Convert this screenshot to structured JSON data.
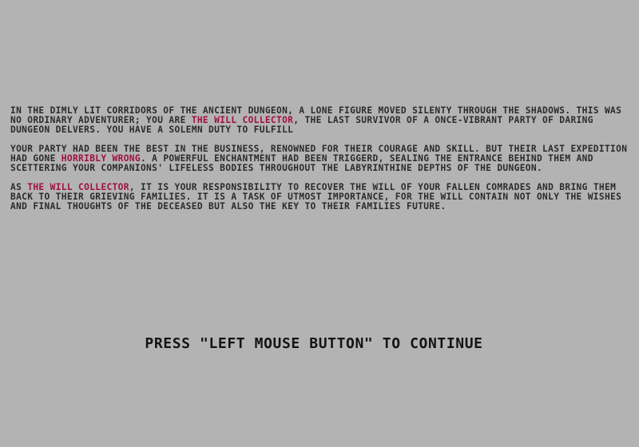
{
  "colors": {
    "background": "#b3b3b3",
    "text": "#2b2b2b",
    "highlight": "#a0103d",
    "prompt": "#141414"
  },
  "story": {
    "p1": {
      "a": "In the dimly lit corridors of the ancient dungeon, a lone figure moved silenty through the shadows. This was no ordinary adventurer; you are ",
      "hl": "The Will Collector",
      "b": ", the last survivor of a once-vibrant party of daring dungeon delvers. You have a solemn duty to fulfill"
    },
    "p2": {
      "a": "Your party had been the best in the business, renowned for their courage and skill. But their last expedition had gone ",
      "hl": "horribly wrong",
      "b": ". A powerful enchantment had been triggerd, sealing the entrance behind them and  scettering your companions' lifeless bodies throughout the labyrinthine depths of the dungeon."
    },
    "p3": {
      "a": "As ",
      "hl": "The Will Collector",
      "b": ", it is your responsibility to recover the will of your fallen comrades and bring them back to their grieving families. It is a task of utmost importance, for the will contain not only the wishes and final thoughts of the deceased but also the key to their families future."
    }
  },
  "prompt": {
    "label": "PRESS \"LEFT MOUSE BUTTON\" TO CONTINUE"
  }
}
